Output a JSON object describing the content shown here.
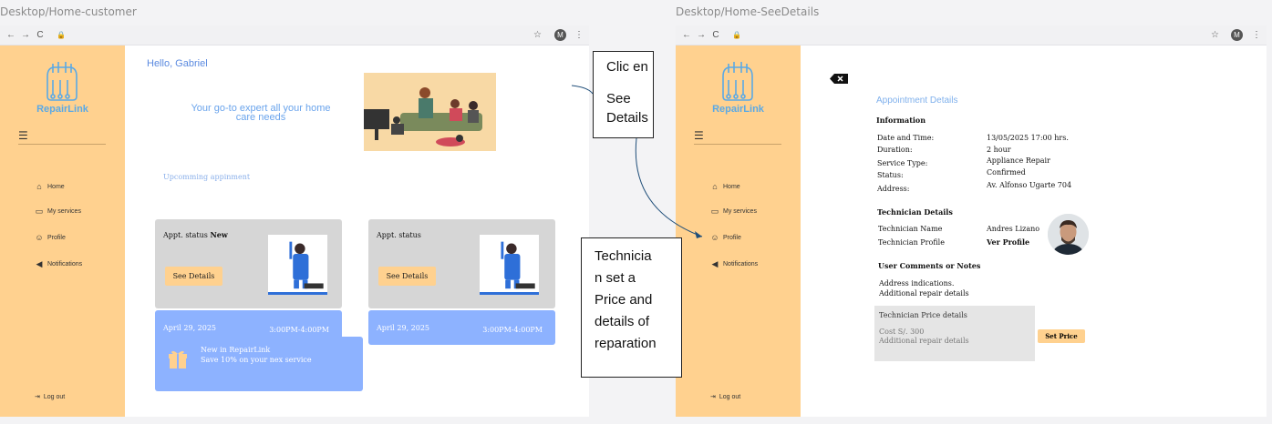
{
  "frames": {
    "left_title": "Desktop/Home-customer",
    "right_title": "Desktop/Home-SeeDetails"
  },
  "browser": {
    "avatar_letter": "M"
  },
  "sidebar": {
    "brand": "RepairLink",
    "items": [
      {
        "label": "Home",
        "icon": "home-icon"
      },
      {
        "label": "My services",
        "icon": "folder-icon"
      },
      {
        "label": "Profile",
        "icon": "user-icon"
      },
      {
        "label": "Notifications",
        "icon": "megaphone-icon"
      }
    ],
    "logout": "Log out"
  },
  "home": {
    "greeting": "Hello, Gabriel",
    "tagline": "Your go-to expert all your home care needs",
    "upcoming_label": "Upcomming appinment",
    "cards": [
      {
        "status_prefix": "Appt. status",
        "status_value": "New",
        "button": "See Details",
        "date": "April 29, 2025",
        "time": "3:00PM-4:00PM"
      },
      {
        "status_prefix": "Appt. status",
        "status_value": "",
        "button": "See Details",
        "date": "April 29, 2025",
        "time": "3:00PM-4:00PM"
      }
    ],
    "promo": {
      "line1": "New in RepairLink",
      "line2": "Save 10% on your nex service"
    }
  },
  "notes": {
    "click": [
      "Clic en",
      "",
      "See",
      "Details"
    ],
    "technician": [
      "Technicia",
      "n set a",
      "Price and",
      "details of",
      "reparation"
    ]
  },
  "details": {
    "title": "Appointment Details",
    "information_heading": "Information",
    "info": [
      {
        "label": "Date and Time:",
        "value": "13/05/2025  17:00 hrs."
      },
      {
        "label": "Duration:",
        "value": "2 hour"
      },
      {
        "label": "Service Type:",
        "value": "Appliance Repair"
      },
      {
        "label": "Status:",
        "value": "Confirmed"
      },
      {
        "label": "Address:",
        "value": "Av. Alfonso Ugarte 704"
      }
    ],
    "technician_heading": "Technician Details",
    "technician_name_label": "Technician Name",
    "technician_name": "Andres Lizano",
    "technician_profile_label": "Technician Profile",
    "technician_profile_link": "Ver Profile",
    "comments_heading": "User Comments or Notes",
    "comment_lines": [
      "Address indications.",
      "Additional repair details"
    ],
    "price_heading": "Technician Price details",
    "price_lines": [
      "Cost S/. 300",
      "Additional repair details"
    ],
    "set_price_button": "Set Price"
  },
  "colors": {
    "sidebar": "#ffd18f",
    "accent_blue": "#8db2ff",
    "brand_blue": "#5aa9e6"
  }
}
